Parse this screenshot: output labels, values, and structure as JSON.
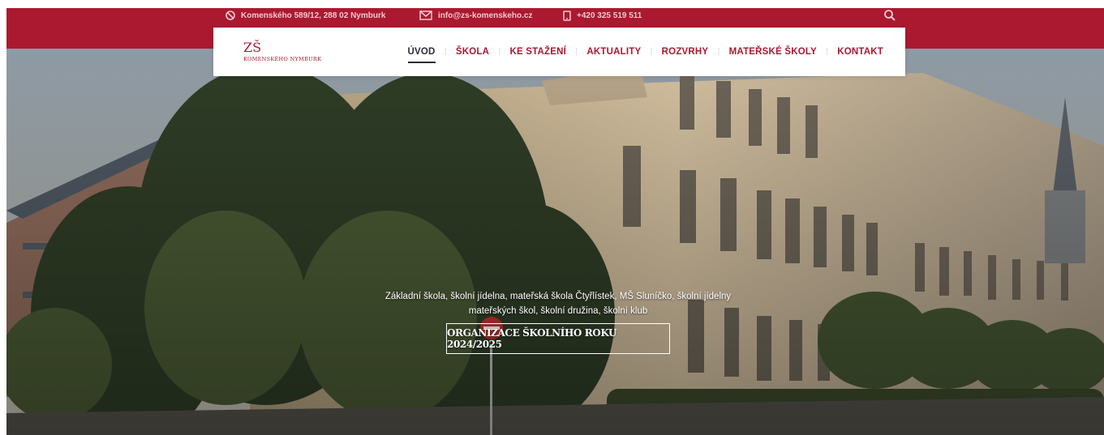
{
  "topbar": {
    "address": "Komenského 589/12, 288 02 Nymburk",
    "email": "info@zs-komenskeho.cz",
    "phone": "+420 325 519 511",
    "background": "#ab1930",
    "icons": {
      "address": "no-entry-circle-icon",
      "email": "envelope-icon",
      "phone": "phone-icon",
      "search": "search-icon"
    }
  },
  "logo": {
    "main": "ZŠ",
    "sub": "KOMENSKÉHO NYMBURK"
  },
  "menu": {
    "items": [
      {
        "label": "ÚVOD",
        "active": true
      },
      {
        "label": "ŠKOLA"
      },
      {
        "label": "KE STAŽENÍ"
      },
      {
        "label": "AKTUALITY"
      },
      {
        "label": "ROZVRHY"
      },
      {
        "label": "MATEŘSKÉ ŠKOLY"
      },
      {
        "label": "KONTAKT"
      }
    ],
    "separator": "⁞",
    "accent": "#ab1930",
    "active_color": "#2b2b3a"
  },
  "hero": {
    "caption_line1": "Základní škola, školní jídelna, mateřská škola Čtyřlístek, MŠ Sluníčko, školní jídelny",
    "caption_line2": "mateřských škol, školní družina, školní klub",
    "cta_label": "ORGANIZACE ŠKOLNÍHO ROKU 2024/2025"
  }
}
